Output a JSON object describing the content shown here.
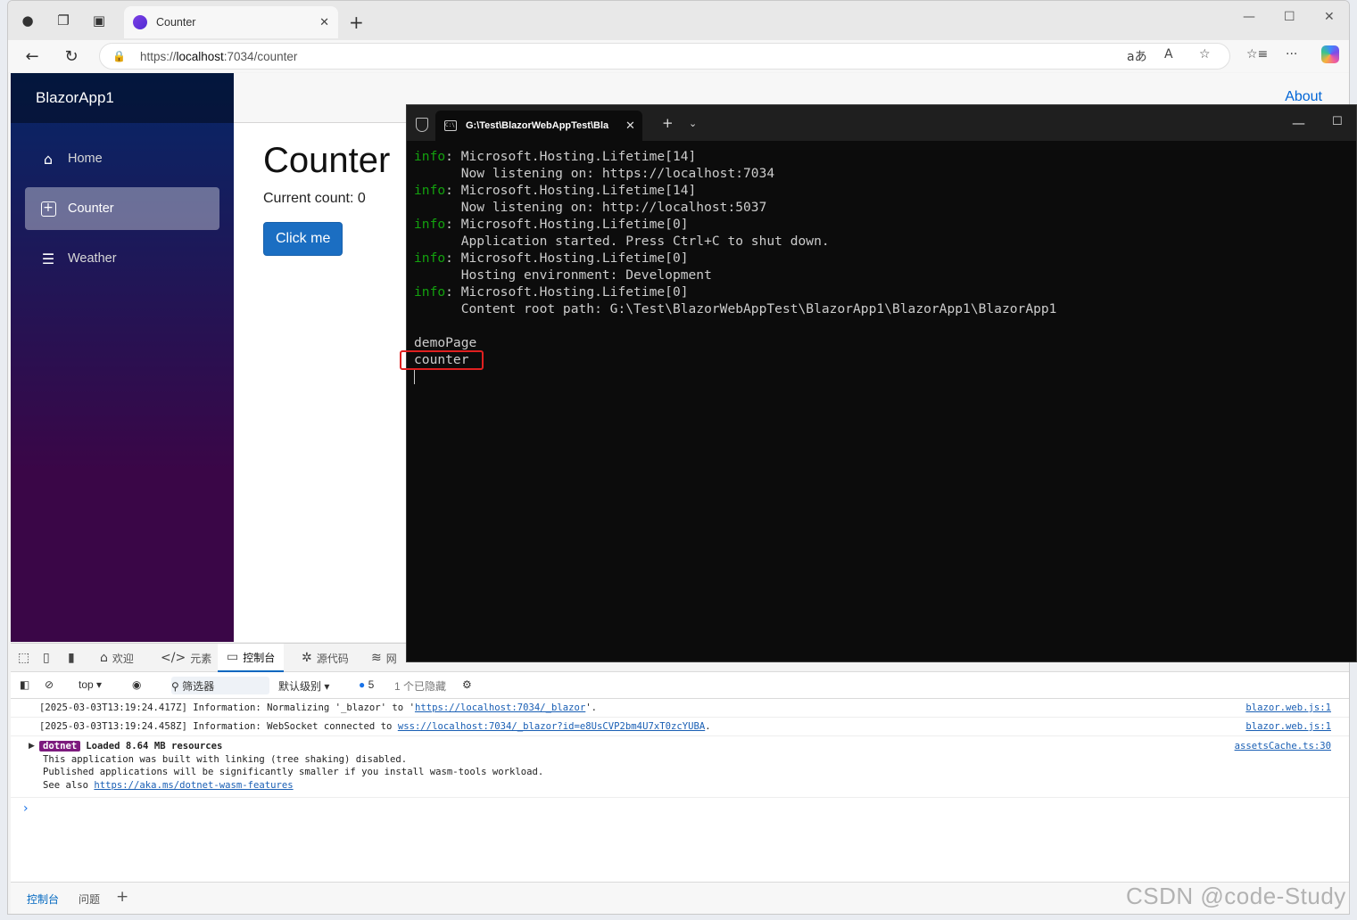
{
  "browser": {
    "tab_title": "Counter",
    "url_scheme": "https://",
    "url_host": "localhost",
    "url_path": ":7034/counter"
  },
  "app": {
    "brand": "BlazorApp1",
    "nav": [
      {
        "label": "Home",
        "icon": "home-icon"
      },
      {
        "label": "Counter",
        "icon": "plus-square-icon"
      },
      {
        "label": "Weather",
        "icon": "list-icon"
      }
    ],
    "about": "About",
    "page_title": "Counter",
    "current_count": "Current count: 0",
    "button_label": "Click me"
  },
  "devtools": {
    "tabs": [
      "欢迎",
      "元素",
      "控制台",
      "源代码",
      "网"
    ],
    "context": "top",
    "filter_label": "筛选器",
    "level": "默认级别",
    "issues_count": "5",
    "hidden": "1 个已隐藏",
    "logs": [
      {
        "prefix": "[2025-03-03T13:19:24.417Z] Information: Normalizing '_blazor' to '",
        "link": "https://localhost:7034/_blazor",
        "suffix": "'.",
        "source": "blazor.web.js:1"
      },
      {
        "prefix": "[2025-03-03T13:19:24.458Z] Information: WebSocket connected to ",
        "link": "wss://localhost:7034/_blazor?id=e8UsCVP2bm4U7xT0zcYUBA",
        "suffix": ".",
        "source": "blazor.web.js:1"
      }
    ],
    "group": {
      "badge": "dotnet",
      "title": "Loaded 8.64 MB resources",
      "lines": [
        "This application was built with linking (tree shaking) disabled.",
        "Published applications will be significantly smaller if you install wasm-tools workload."
      ],
      "see_also": "See also ",
      "link": "https://aka.ms/dotnet-wasm-features",
      "source": "assetsCache.ts:30"
    },
    "drawer_tabs": [
      "控制台",
      "问题"
    ]
  },
  "terminal": {
    "title": "G:\\Test\\BlazorWebAppTest\\Bla",
    "lines": [
      {
        "lvl": "info",
        "text": "Microsoft.Hosting.Lifetime[14]"
      },
      {
        "lvl": "",
        "text": "      Now listening on: https://localhost:7034"
      },
      {
        "lvl": "info",
        "text": "Microsoft.Hosting.Lifetime[14]"
      },
      {
        "lvl": "",
        "text": "      Now listening on: http://localhost:5037"
      },
      {
        "lvl": "info",
        "text": "Microsoft.Hosting.Lifetime[0]"
      },
      {
        "lvl": "",
        "text": "      Application started. Press Ctrl+C to shut down."
      },
      {
        "lvl": "info",
        "text": "Microsoft.Hosting.Lifetime[0]"
      },
      {
        "lvl": "",
        "text": "      Hosting environment: Development"
      },
      {
        "lvl": "info",
        "text": "Microsoft.Hosting.Lifetime[0]"
      },
      {
        "lvl": "",
        "text": "      Content root path: G:\\Test\\BlazorWebAppTest\\BlazorApp1\\BlazorApp1\\BlazorApp1"
      },
      {
        "lvl": "",
        "text": ""
      },
      {
        "lvl": "",
        "text": "demoPage"
      },
      {
        "lvl": "",
        "text": "counter"
      }
    ]
  },
  "watermark": "CSDN @code-Study",
  "colors": {
    "accent": "#1b6ec2",
    "terminal_info": "#13a10e",
    "highlight": "#e02020"
  }
}
